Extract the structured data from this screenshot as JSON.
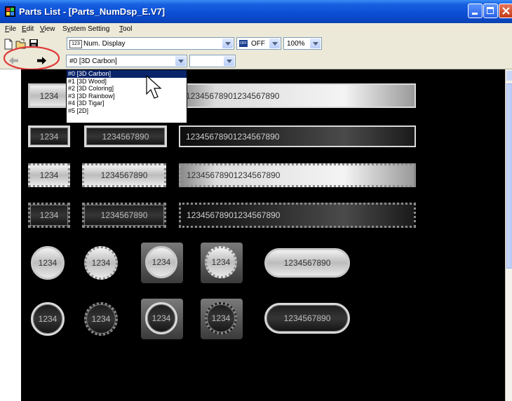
{
  "window": {
    "title": "Parts List - [Parts_NumDsp_E.V7]",
    "buttons": [
      "minimize",
      "maximize",
      "close"
    ]
  },
  "menu": {
    "items": [
      {
        "label": "File",
        "accel": "F",
        "rest": "ile"
      },
      {
        "label": "Edit",
        "accel": "E",
        "rest": "dit"
      },
      {
        "label": "View",
        "accel": "V",
        "rest": "iew"
      },
      {
        "label": "System Setting",
        "accel": "y",
        "pre": "S",
        "rest": "stem Setting"
      },
      {
        "label": "Tool",
        "accel": "T",
        "rest": "ool"
      }
    ]
  },
  "toolbar": {
    "parts_type": {
      "icon": "123",
      "value": "Num. Display"
    },
    "state": {
      "icon": "OFF",
      "value": "OFF"
    },
    "zoom": {
      "value": "100%"
    },
    "style": {
      "value": "#0 [3D Carbon]"
    },
    "extra": {
      "value": ""
    }
  },
  "style_options": [
    "#0 [3D Carbon]",
    "#1 [3D Wood]",
    "#2 [3D Coloring]",
    "#3 [3D Rainbow]",
    "#4 [3D Tigar]",
    "#5 [2D]"
  ],
  "selected_style_index": 0,
  "samples": {
    "short": "1234",
    "medium": "1234567890",
    "long": "12345678901234567890"
  },
  "colors": {
    "titlebar": "#0b4fd6",
    "face": "#ece9d8",
    "canvas": "#000000",
    "selection": "#0a246a",
    "highlight_ring": "#e03a3a"
  }
}
